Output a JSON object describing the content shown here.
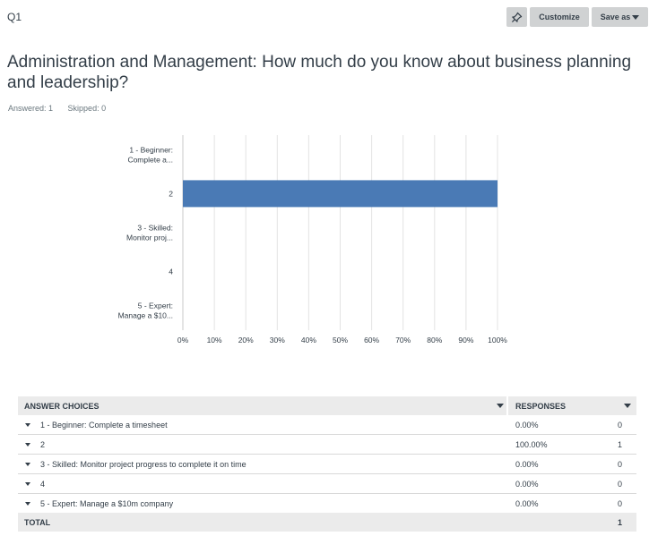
{
  "question": {
    "id": "Q1",
    "title": "Administration and Management: How much do you know about business planning and leadership?",
    "answered": "Answered: 1",
    "skipped": "Skipped: 0"
  },
  "toolbar": {
    "pin_icon": "pin-icon",
    "customize_label": "Customize",
    "save_label": "Save as"
  },
  "chart_data": {
    "type": "bar",
    "orientation": "horizontal",
    "categories": [
      "1 - Beginner: Complete a...",
      "2",
      "3 - Skilled: Monitor proj...",
      "4",
      "5 - Expert: Manage a $10..."
    ],
    "values": [
      0,
      100,
      0,
      0,
      0
    ],
    "xlim": [
      0,
      100
    ],
    "xticks": [
      "0%",
      "10%",
      "20%",
      "30%",
      "40%",
      "50%",
      "60%",
      "70%",
      "80%",
      "90%",
      "100%"
    ],
    "grid": true,
    "bar_color": "#4a7ab5"
  },
  "table": {
    "headers": {
      "choices": "ANSWER CHOICES",
      "responses": "RESPONSES"
    },
    "rows": [
      {
        "choice": "1 - Beginner: Complete a timesheet",
        "percent": "0.00%",
        "count": "0"
      },
      {
        "choice": "2",
        "percent": "100.00%",
        "count": "1"
      },
      {
        "choice": "3 - Skilled: Monitor project progress to complete it on time",
        "percent": "0.00%",
        "count": "0"
      },
      {
        "choice": "4",
        "percent": "0.00%",
        "count": "0"
      },
      {
        "choice": "5 - Expert: Manage a $10m company",
        "percent": "0.00%",
        "count": "0"
      }
    ],
    "total": {
      "label": "TOTAL",
      "count": "1"
    }
  }
}
